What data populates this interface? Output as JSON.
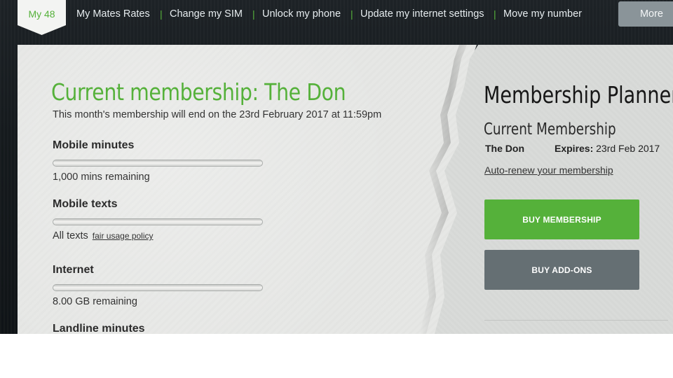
{
  "nav": {
    "active_tab": "My 48",
    "links": [
      "My Mates Rates",
      "Change my SIM",
      "Unlock my phone",
      "Update my internet settings",
      "Move my number"
    ],
    "separator": "|",
    "more_label": "More"
  },
  "membership": {
    "title": "Current membership: The Don",
    "subtitle": "This month's membership will end on the 23rd February 2017 at 11:59pm",
    "usage": [
      {
        "label": "Mobile minutes",
        "note": "1,000 mins remaining",
        "link": "",
        "fill_fraction": 0
      },
      {
        "label": "Mobile texts",
        "note": "All texts",
        "link": "fair usage policy",
        "fill_fraction": 0
      },
      {
        "label": "Internet",
        "note": "8.00 GB remaining",
        "link": "",
        "fill_fraction": 0
      },
      {
        "label": "Landline minutes",
        "note": "",
        "link": "",
        "fill_fraction": 0
      }
    ]
  },
  "planner": {
    "title": "Membership Planner",
    "current_heading": "Current Membership",
    "plan_name": "The Don",
    "expires_label": "Expires:",
    "expires_value": "23rd Feb 2017",
    "auto_renew": "Auto-renew your membership",
    "buy_membership": "BUY MEMBERSHIP",
    "buy_addons": "BUY ADD-ONS"
  },
  "colors": {
    "accent_green": "#55b13a",
    "addons_grey": "#656f73",
    "more_grey": "#8a9499"
  }
}
